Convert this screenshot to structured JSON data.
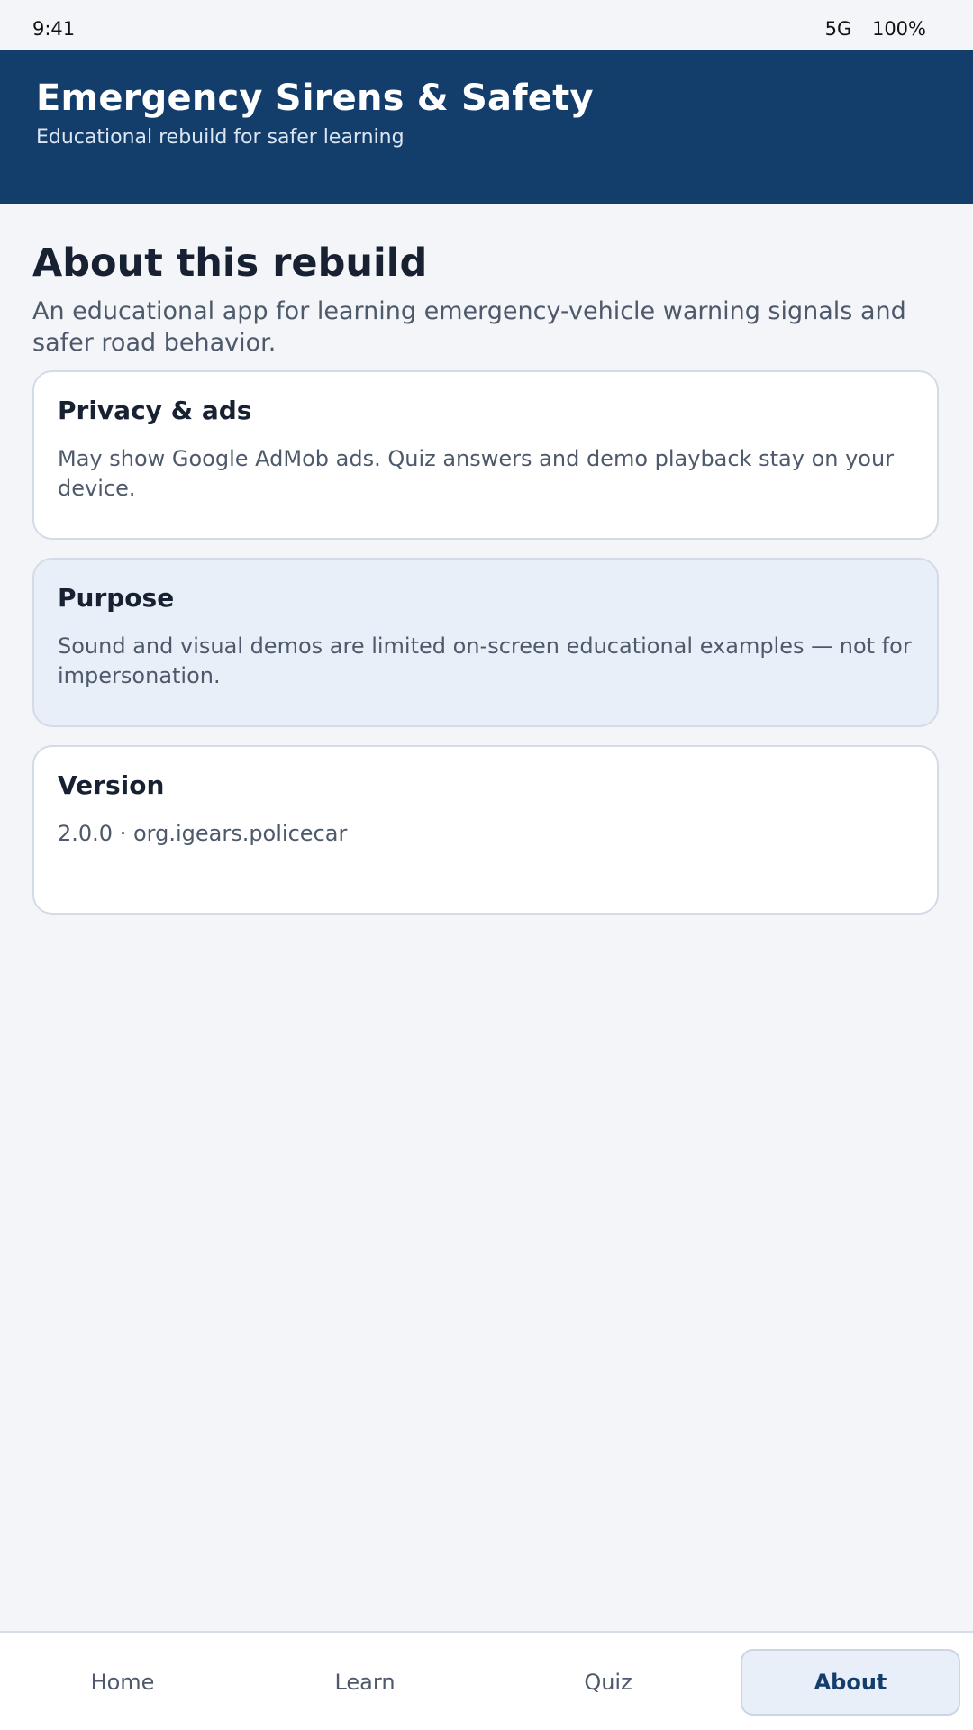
{
  "status_bar": {
    "time": "9:41",
    "network": "5G",
    "battery": "100%"
  },
  "header": {
    "title": "Emergency Sirens & Safety",
    "subtitle": "Educational rebuild for safer learning"
  },
  "main": {
    "title": "About this rebuild",
    "intro": "An educational app for learning emergency-vehicle warning signals and safer road behavior.",
    "cards": [
      {
        "title": "Privacy & ads",
        "body": "May show Google AdMob ads. Quiz answers and demo playback stay on your device."
      },
      {
        "title": "Purpose",
        "body": "Sound and visual demos are limited on-screen educational examples — not for impersonation."
      },
      {
        "title": "Version",
        "body": "2.0.0 · org.igears.policecar"
      }
    ]
  },
  "nav": {
    "items": [
      {
        "label": "Home"
      },
      {
        "label": "Learn"
      },
      {
        "label": "Quiz"
      },
      {
        "label": "About",
        "active": true
      }
    ]
  },
  "colors": {
    "header_bg": "#133e6b",
    "page_bg": "#f3f5f9",
    "card_bg": "#ffffff",
    "card_alt_bg": "#e8eff8",
    "active_text": "#133e6b"
  }
}
